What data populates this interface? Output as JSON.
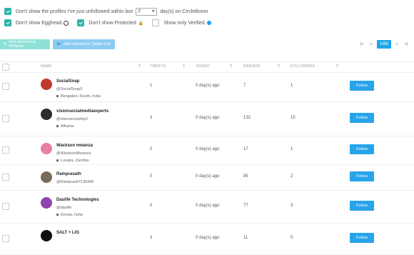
{
  "filters": {
    "unfollowed_prefix": "Don't show the profiles I've just unfollowed within last",
    "unfollowed_days": "7",
    "unfollowed_suffix": "day(s) on CircleBoom",
    "egghead": "Don't show Egghead",
    "protected": "Don't show Protected",
    "verified": "Show only Verified"
  },
  "actions": {
    "add_whitelist": "Add selected to Whitelist",
    "add_twitter_list": "Add selected to Twitter List"
  },
  "pagination": {
    "first": "|«",
    "prev": "«",
    "current": "1/66",
    "next": "»",
    "last": "»|"
  },
  "table": {
    "headers": {
      "name": "NAME",
      "tweets": "TWEETS",
      "joined": "JOINED",
      "friends": "FRIENDS",
      "followers": "FOLLOWERS"
    },
    "follow_label": "Follow",
    "rows": [
      {
        "name": "SocialSnap",
        "handle": "@SocialSnap3",
        "location": "Bengaluru South, India",
        "tweets": "1",
        "joined": "0 day(s) ago",
        "friends": "7",
        "followers": "1",
        "avatar_color": "#c0392b"
      },
      {
        "name": "visionsocialmediaexperts",
        "handle": "@visionsocialmp1",
        "location": "Albania",
        "tweets": "3",
        "joined": "0 day(s) ago",
        "friends": "132",
        "followers": "15",
        "avatar_color": "#2c2c2c"
      },
      {
        "name": "Wackson mwanza",
        "handle": "@WacksonMwanza",
        "location": "Lusaka, Zambia",
        "tweets": "0",
        "joined": "0 day(s) ago",
        "friends": "17",
        "followers": "1",
        "avatar_color": "#e87fa6"
      },
      {
        "name": "Ramprasath",
        "handle": "@Rampras87130440",
        "location": "",
        "tweets": "0",
        "joined": "0 day(s) ago",
        "friends": "85",
        "followers": "2",
        "avatar_color": "#7a6a5a"
      },
      {
        "name": "Daslife Technologies",
        "handle": "@daslife",
        "location": "Kerala, India",
        "tweets": "0",
        "joined": "0 day(s) ago",
        "friends": "77",
        "followers": "3",
        "avatar_color": "#8e44ad"
      },
      {
        "name": "SALT + LIG",
        "handle": "",
        "location": "",
        "tweets": "3",
        "joined": "0 day(s) ago",
        "friends": "11",
        "followers": "0",
        "avatar_color": "#111111"
      }
    ]
  }
}
